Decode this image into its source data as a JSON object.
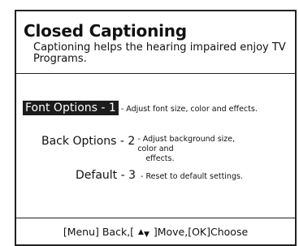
{
  "screen": {
    "title": "Closed Captioning",
    "subtitle": "Captioning helps the hearing impaired enjoy TV Programs."
  },
  "menu": {
    "items": [
      {
        "label": "Font Options - 1",
        "description": " - Adjust font size, color and effects.",
        "selected": true
      },
      {
        "label": "Back Options - 2",
        "description_line1": " - Adjust background size, color and",
        "description_line2": "effects.",
        "selected": false
      },
      {
        "label": "Default - 3",
        "description": " - Reset to default settings.",
        "selected": false
      }
    ]
  },
  "footer": {
    "prefix": "[Menu] Back,[ ",
    "up_arrow": "▲",
    "down_arrow": "▼",
    "suffix": " ]Move,[OK]Choose"
  },
  "colors": {
    "selected_background": "#1c1c1c",
    "selected_text": "#ffffff",
    "border": "#222222",
    "background": "#ffffff"
  }
}
